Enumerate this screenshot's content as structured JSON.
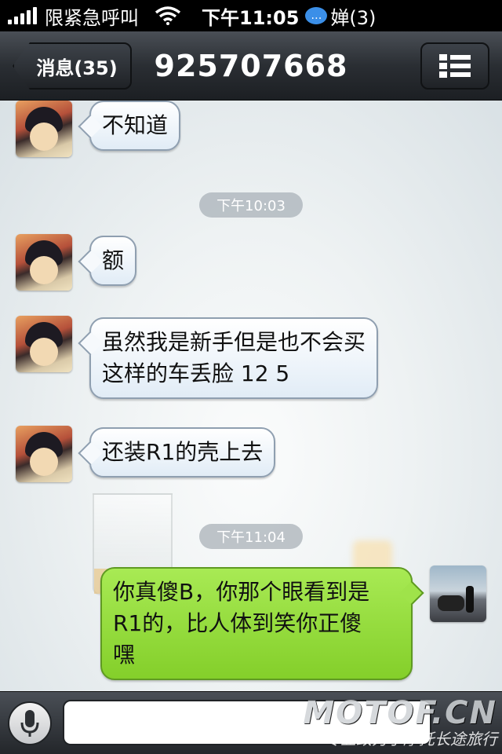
{
  "status_bar": {
    "carrier": "限紧急呼叫",
    "time": "下午11:05",
    "notification": "婵(3)"
  },
  "nav": {
    "back_label": "消息(35)",
    "title": "925707668",
    "menu_icon": "list-icon"
  },
  "messages": [
    {
      "direction": "in",
      "text": "不知道"
    },
    {
      "type": "timestamp",
      "text": "下午10:03"
    },
    {
      "direction": "in",
      "text": "额"
    },
    {
      "direction": "in",
      "line1": "虽然我是新手但是也不会买",
      "line2": "这样的车丢脸 12 5"
    },
    {
      "direction": "in",
      "text": "还装R1的壳上去"
    },
    {
      "type": "timestamp",
      "text": "下午11:04"
    },
    {
      "direction": "out",
      "line1": "你真傻B，你那个眼看到是",
      "line2": "R1的，比人体到笑你正傻",
      "line3": "嘿"
    }
  ],
  "input": {
    "value": "",
    "mic_icon": "microphone-icon"
  },
  "watermark": {
    "logo": "MOTOF.CN",
    "slogan": "专业致力于摩托长途旅行"
  },
  "colors": {
    "incoming_bubble": "#e1ecf6",
    "outgoing_bubble": "#84cf2a",
    "navbar": "#2a2e33"
  }
}
